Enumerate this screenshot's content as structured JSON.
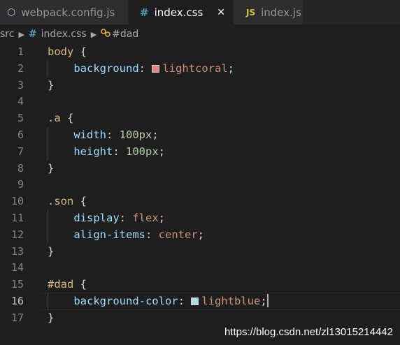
{
  "tabs": [
    {
      "label": "webpack.config.js",
      "icon": "webpack-icon"
    },
    {
      "label": "index.css",
      "icon": "css-hash-icon",
      "active": true,
      "close": "✕"
    },
    {
      "label": "index.js",
      "icon": "js-icon",
      "icon_text": "JS"
    }
  ],
  "breadcrumb": {
    "folder": "src",
    "file": "index.css",
    "file_icon": "#",
    "selector": "#dad"
  },
  "colors": {
    "lightcoral": "#f08080",
    "lightblue": "#add8e6"
  },
  "line_numbers": [
    "1",
    "2",
    "3",
    "4",
    "5",
    "6",
    "7",
    "8",
    "9",
    "10",
    "11",
    "12",
    "13",
    "14",
    "15",
    "16",
    "17"
  ],
  "active_line": "16",
  "code": {
    "l1_sel": "body",
    "l2_prop": "background",
    "l2_val": "lightcoral",
    "l5_sel": ".a",
    "l6_prop": "width",
    "l6_val": "100px",
    "l7_prop": "height",
    "l7_val": "100px",
    "l10_sel": ".son",
    "l11_prop": "display",
    "l11_val": "flex",
    "l12_prop": "align-items",
    "l12_val": "center",
    "l15_sel": "#dad",
    "l16_prop": "background-color",
    "l16_val": "lightblue"
  },
  "watermark": "https://blog.csdn.net/zl13015214442"
}
